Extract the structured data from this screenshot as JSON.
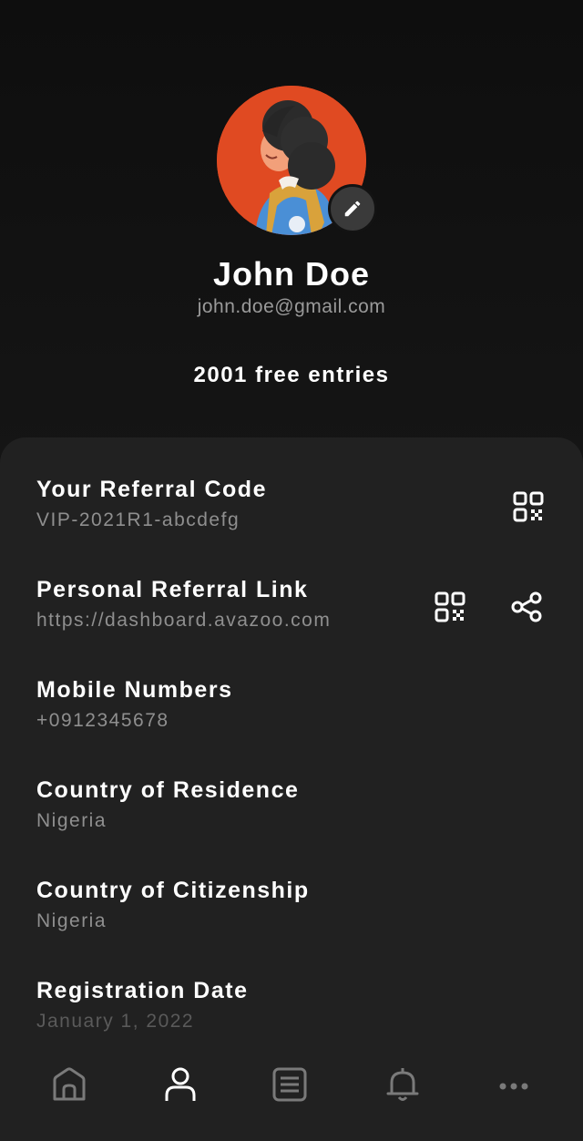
{
  "profile": {
    "name": "John Doe",
    "email": "john.doe@gmail.com",
    "entries": "2001 free entries",
    "avatar_icon": "avatar-illustration",
    "edit_icon": "pencil-icon"
  },
  "details": [
    {
      "label": "Your Referral Code",
      "value": "VIP-2021R1-abcdefg"
    },
    {
      "label": "Personal Referral Link",
      "value": "https://dashboard.avazoo.com"
    },
    {
      "label": "Mobile Numbers",
      "value": "+0912345678"
    },
    {
      "label": "Country of Residence",
      "value": "Nigeria"
    },
    {
      "label": "Country of Citizenship",
      "value": "Nigeria"
    },
    {
      "label": "Registration Date",
      "value": "January 1, 2022"
    }
  ],
  "nav": {
    "items": [
      "home-icon",
      "profile-icon",
      "list-icon",
      "bell-icon",
      "more-icon"
    ],
    "active": "profile-icon"
  },
  "colors": {
    "background": "#131313",
    "panel": "#212121",
    "avatar_bg": "#e04a22",
    "text": "#ffffff",
    "muted": "#8f8f8f"
  }
}
